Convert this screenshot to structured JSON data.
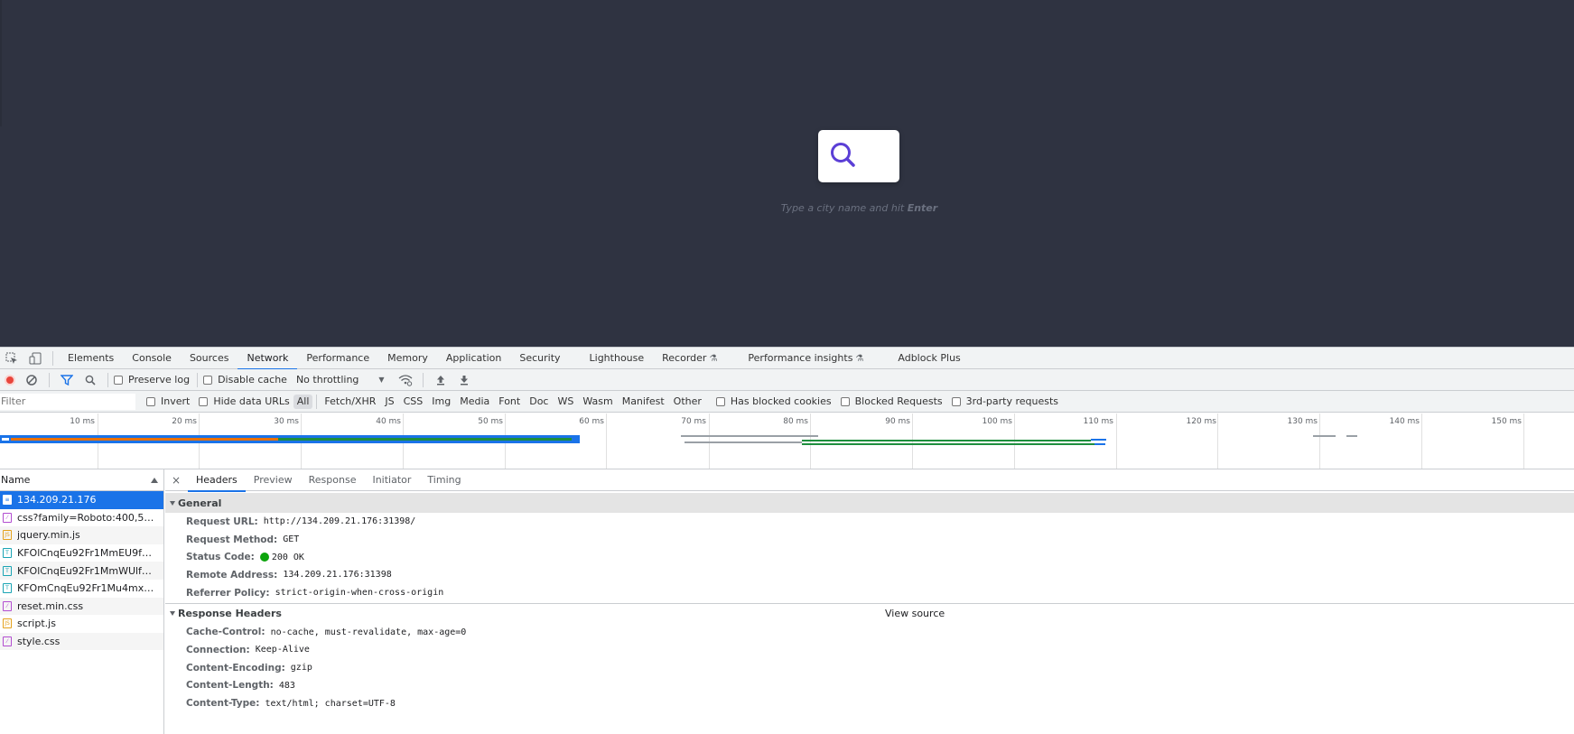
{
  "page": {
    "hint_prefix": "Type a city name and hit ",
    "hint_key": "Enter"
  },
  "devtools": {
    "tabs": [
      "Elements",
      "Console",
      "Sources",
      "Network",
      "Performance",
      "Memory",
      "Application",
      "Security",
      "Lighthouse",
      "Recorder",
      "Performance insights",
      "Adblock Plus"
    ],
    "active_tab": "Network",
    "toolbar": {
      "preserve_log": "Preserve log",
      "disable_cache": "Disable cache",
      "throttling": "No throttling"
    },
    "filterbar": {
      "filter_placeholder": "Filter",
      "invert": "Invert",
      "hide_data_urls": "Hide data URLs",
      "types": [
        "All",
        "Fetch/XHR",
        "JS",
        "CSS",
        "Img",
        "Media",
        "Font",
        "Doc",
        "WS",
        "Wasm",
        "Manifest",
        "Other"
      ],
      "active_type": "All",
      "has_blocked_cookies": "Has blocked cookies",
      "blocked_requests": "Blocked Requests",
      "third_party": "3rd-party requests"
    },
    "overview": {
      "ticks": [
        "10 ms",
        "20 ms",
        "30 ms",
        "40 ms",
        "50 ms",
        "60 ms",
        "70 ms",
        "80 ms",
        "90 ms",
        "100 ms",
        "110 ms",
        "120 ms",
        "130 ms",
        "140 ms",
        "150 ms"
      ]
    },
    "request_list": {
      "column": "Name",
      "rows": [
        {
          "name": "134.209.21.176",
          "type": "doc"
        },
        {
          "name": "css?family=Roboto:400,500,...",
          "type": "css"
        },
        {
          "name": "jquery.min.js",
          "type": "js"
        },
        {
          "name": "KFOlCnqEu92Fr1MmEU9fB...",
          "type": "font"
        },
        {
          "name": "KFOlCnqEu92Fr1MmWUlfB...",
          "type": "font"
        },
        {
          "name": "KFOmCnqEu92Fr1Mu4mxK....",
          "type": "font"
        },
        {
          "name": "reset.min.css",
          "type": "css"
        },
        {
          "name": "script.js",
          "type": "js"
        },
        {
          "name": "style.css",
          "type": "css"
        }
      ]
    },
    "details": {
      "close": "×",
      "tabs": [
        "Headers",
        "Preview",
        "Response",
        "Initiator",
        "Timing"
      ],
      "active_tab": "Headers",
      "general_title": "General",
      "general": [
        {
          "key": "Request URL:",
          "value": "http://134.209.21.176:31398/"
        },
        {
          "key": "Request Method:",
          "value": "GET"
        },
        {
          "key": "Status Code:",
          "value": "200 OK"
        },
        {
          "key": "Remote Address:",
          "value": "134.209.21.176:31398"
        },
        {
          "key": "Referrer Policy:",
          "value": "strict-origin-when-cross-origin"
        }
      ],
      "response_title": "Response Headers",
      "view_source": "View source",
      "response": [
        {
          "key": "Cache-Control:",
          "value": "no-cache, must-revalidate, max-age=0"
        },
        {
          "key": "Connection:",
          "value": "Keep-Alive"
        },
        {
          "key": "Content-Encoding:",
          "value": "gzip"
        },
        {
          "key": "Content-Length:",
          "value": "483"
        },
        {
          "key": "Content-Type:",
          "value": "text/html; charset=UTF-8"
        }
      ]
    }
  },
  "colors": {
    "page_bg": "#2f3341",
    "accent": "#1a73e8",
    "search_icon": "#5b3fd6",
    "status_ok": "#0ca40c"
  }
}
